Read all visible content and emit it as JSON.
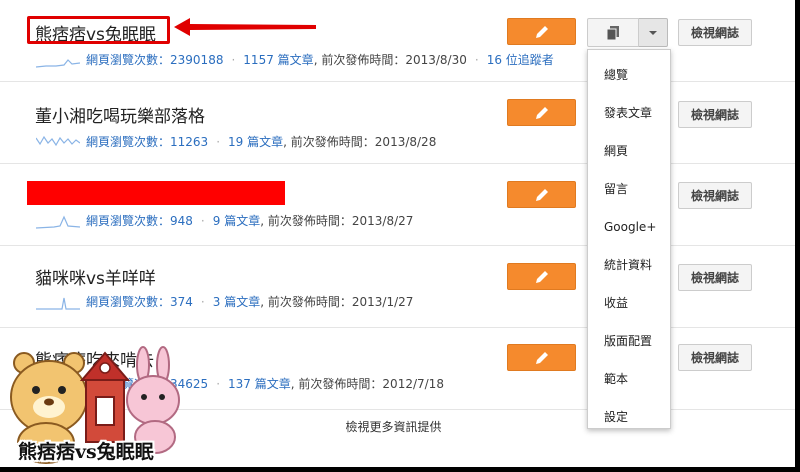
{
  "blogs": [
    {
      "title": "熊痞痞vs兔眠眠",
      "views_label": "網頁瀏覽次數：",
      "views": "2390188",
      "posts": "1157",
      "posts_label": "篇文章",
      "last_post_label": ", 前次發佈時間：",
      "last_post": "2013/8/30",
      "followers": "16 位追蹤者"
    },
    {
      "title": "董小湘吃喝玩樂部落格",
      "views_label": "網頁瀏覽次數：",
      "views": "11263",
      "posts": "19",
      "posts_label": "篇文章",
      "last_post_label": ", 前次發佈時間：",
      "last_post": "2013/8/28"
    },
    {
      "title": "",
      "views_label": "網頁瀏覽次數：",
      "views": "948",
      "posts": "9",
      "posts_label": "篇文章",
      "last_post_label": ", 前次發佈時間：",
      "last_post": "2013/8/27"
    },
    {
      "title": "貓咪咪vs羊咩咩",
      "views_label": "網頁瀏覽次數：",
      "views": "374",
      "posts": "3",
      "posts_label": "篇文章",
      "last_post_label": ", 前次發佈時間：",
      "last_post": "2013/1/27"
    },
    {
      "title": "熊痞痞吃來啃去",
      "views_label": "網頁瀏覽次數：",
      "views": "34625",
      "posts": "137",
      "posts_label": "篇文章",
      "last_post_label": ", 前次發佈時間：",
      "last_post": "2012/7/18"
    }
  ],
  "view_blog_label": "檢視網誌",
  "menu_items": [
    "總覽",
    "發表文章",
    "網頁",
    "留言",
    "Google+",
    "統計資料",
    "收益",
    "版面配置",
    "範本",
    "設定"
  ],
  "more_link": "檢視更多資訊提供",
  "watermark_text": "熊痞痞vs兔眠眠",
  "colors": {
    "edit": "#f58a2d",
    "link": "#2b6ebf",
    "redaction": "#ff0000",
    "highlight": "#e00000"
  },
  "icons": {
    "edit": "pencil-icon",
    "posts": "documents-icon",
    "menu": "caret-down-icon"
  }
}
